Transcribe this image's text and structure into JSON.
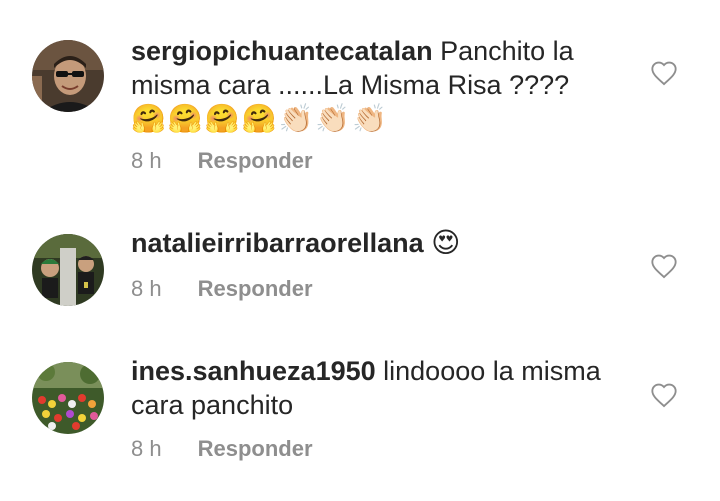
{
  "comments": [
    {
      "username": "sergiopichuantecatalan",
      "text": " Panchito la misma cara ......La Misma Risa ????",
      "emojis": [
        "🤗",
        "🤗",
        "🤗",
        "🤗",
        "👏🏻",
        "👏🏻",
        "👏🏻"
      ],
      "time": "8 h",
      "reply_label": "Responder"
    },
    {
      "username": "natalieirribarraorellana",
      "text": " ",
      "emoji": "😍",
      "time": "8 h",
      "reply_label": "Responder"
    },
    {
      "username": "ines.sanhueza1950",
      "text": " lindoooo la misma cara panchito",
      "time": "8 h",
      "reply_label": "Responder"
    }
  ],
  "icons": {
    "like": "heart-outline-icon"
  },
  "colors": {
    "text": "#262626",
    "meta": "#8e8e8e"
  }
}
